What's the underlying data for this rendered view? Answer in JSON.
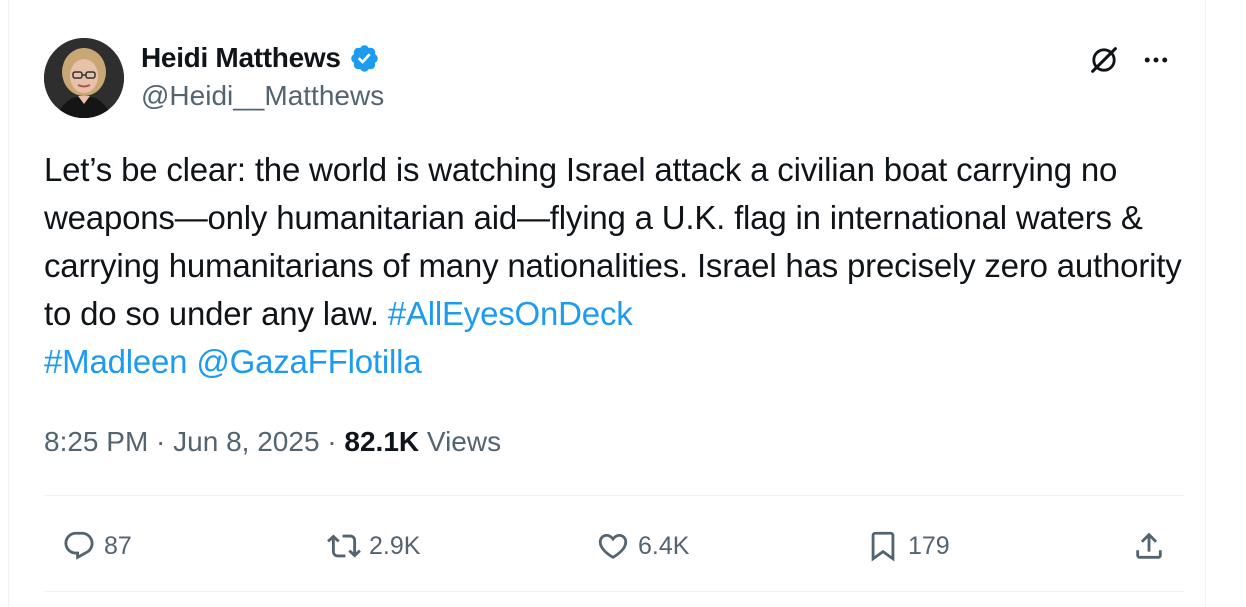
{
  "author": {
    "display_name": "Heidi Matthews",
    "handle": "@Heidi__Matthews",
    "verified": true,
    "verified_color": "#1d9bf0"
  },
  "tweet": {
    "text_segments": [
      {
        "text": "Let’s be clear: the world is watching Israel attack a civilian boat carrying no weapons—only humanitarian aid—flying a U.K. flag in international waters & carrying humanitarians of many nationalities. Israel has precisely zero authority to do so under any law. ",
        "type": "text"
      },
      {
        "text": "#AllEyesOnDeck",
        "type": "link"
      },
      {
        "text": " ",
        "type": "text"
      },
      {
        "text": "#Madleen",
        "type": "link"
      },
      {
        "text": " ",
        "type": "text"
      },
      {
        "text": "@GazaFFlotilla",
        "type": "link"
      }
    ],
    "link_color": "#1d9bf0"
  },
  "meta": {
    "time": "8:25 PM",
    "separator": " · ",
    "date": "Jun 8, 2025",
    "views_count": "82.1K",
    "views_label": " Views"
  },
  "actions": {
    "replies": "87",
    "reposts": "2.9K",
    "likes": "6.4K",
    "bookmarks": "179"
  },
  "icons": {
    "grok": "grok-icon",
    "more": "more-icon",
    "reply": "reply-icon",
    "repost": "repost-icon",
    "like": "heart-icon",
    "bookmark": "bookmark-icon",
    "share": "share-icon"
  }
}
